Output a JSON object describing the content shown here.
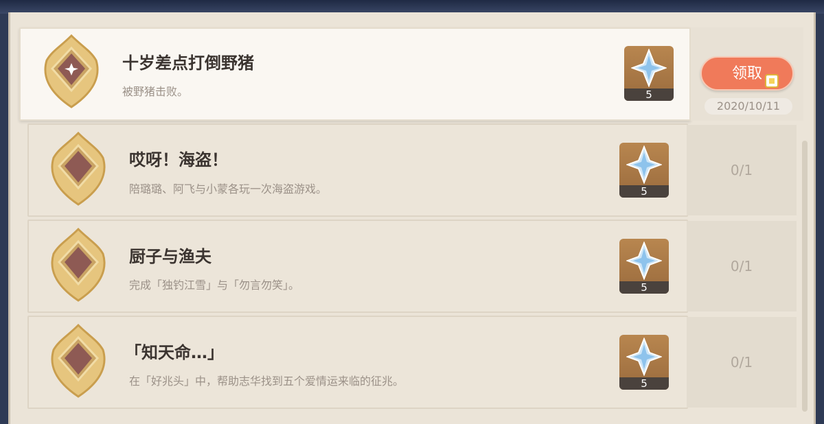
{
  "colors": {
    "background": "#ebe4d8",
    "highlight_row": "#faf7f2",
    "claim_button": "#f07a5a",
    "reward_bg": "#b8864f",
    "title_text": "#3b3430",
    "desc_text": "#9b9188"
  },
  "achievements": [
    {
      "title": "十岁差点打倒野猪",
      "description": "被野猪击败。",
      "reward_icon": "primogem-icon",
      "reward_count": "5",
      "claim_label": "领取",
      "date": "2020/10/11",
      "completed": true
    },
    {
      "title": "哎呀！海盗！",
      "description": "陪璐璐、阿飞与小蒙各玩一次海盗游戏。",
      "reward_icon": "primogem-icon",
      "reward_count": "5",
      "progress": "0/1",
      "completed": false
    },
    {
      "title": "厨子与渔夫",
      "description": "完成「独钓江雪」与「勿言勿笑」。",
      "reward_icon": "primogem-icon",
      "reward_count": "5",
      "progress": "0/1",
      "completed": false
    },
    {
      "title": "「知天命…」",
      "description": "在「好兆头」中，帮助志华找到五个爱情运来临的征兆。",
      "reward_icon": "primogem-icon",
      "reward_count": "5",
      "progress": "0/1",
      "completed": false
    }
  ]
}
